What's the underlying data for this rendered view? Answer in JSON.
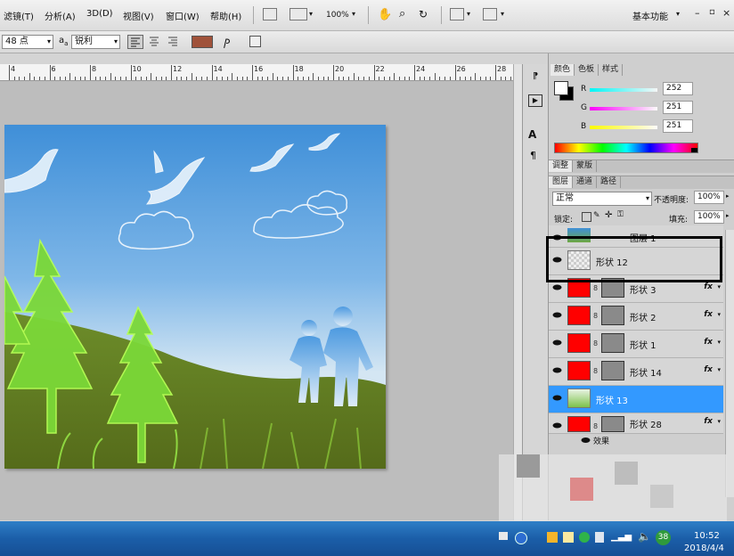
{
  "menubar": {
    "items": [
      "滤镜(T)",
      "分析(A)",
      "3D(D)",
      "视图(V)",
      "窗口(W)",
      "帮助(H)"
    ],
    "zoom": "100%",
    "workspace": "基本功能"
  },
  "options": {
    "font_size": "48 点",
    "aa_label": "a",
    "antialias": "锐利"
  },
  "ruler": {
    "numbers": [
      "4",
      "6",
      "8",
      "10",
      "12",
      "14",
      "16",
      "18",
      "20",
      "22",
      "24",
      "26",
      "28"
    ]
  },
  "color_panel": {
    "tabs": [
      "颜色",
      "色板",
      "样式"
    ],
    "channels": [
      {
        "label": "R",
        "value": "252"
      },
      {
        "label": "G",
        "value": "251"
      },
      {
        "label": "B",
        "value": "251"
      }
    ]
  },
  "adjust_tabs": [
    "调整",
    "蒙版"
  ],
  "layers_panel": {
    "tabs": [
      "图层",
      "通道",
      "路径"
    ],
    "blend_mode": "正常",
    "opacity_label": "不透明度:",
    "opacity": "100%",
    "lock_label": "锁定:",
    "fill_label": "填充:",
    "fill": "100%",
    "layers": [
      {
        "name": "图层 1",
        "type": "image",
        "fx": ""
      },
      {
        "name": "形状 12",
        "type": "empty",
        "fx": ""
      },
      {
        "name": "形状 3",
        "type": "shape",
        "fx": "fx"
      },
      {
        "name": "形状 2",
        "type": "shape",
        "fx": "fx"
      },
      {
        "name": "形状 1",
        "type": "shape",
        "fx": "fx"
      },
      {
        "name": "形状 14",
        "type": "shape",
        "fx": "fx"
      },
      {
        "name": "形状 13",
        "type": "selected",
        "fx": ""
      },
      {
        "name": "形状 28",
        "type": "shape",
        "fx": "fx"
      }
    ],
    "effects_label": "效果"
  },
  "taskbar": {
    "time": "10:52",
    "date": "2018/4/4",
    "badge": "38"
  },
  "colors": {
    "selection": "#3399ff",
    "highlight_box": "#000000"
  }
}
